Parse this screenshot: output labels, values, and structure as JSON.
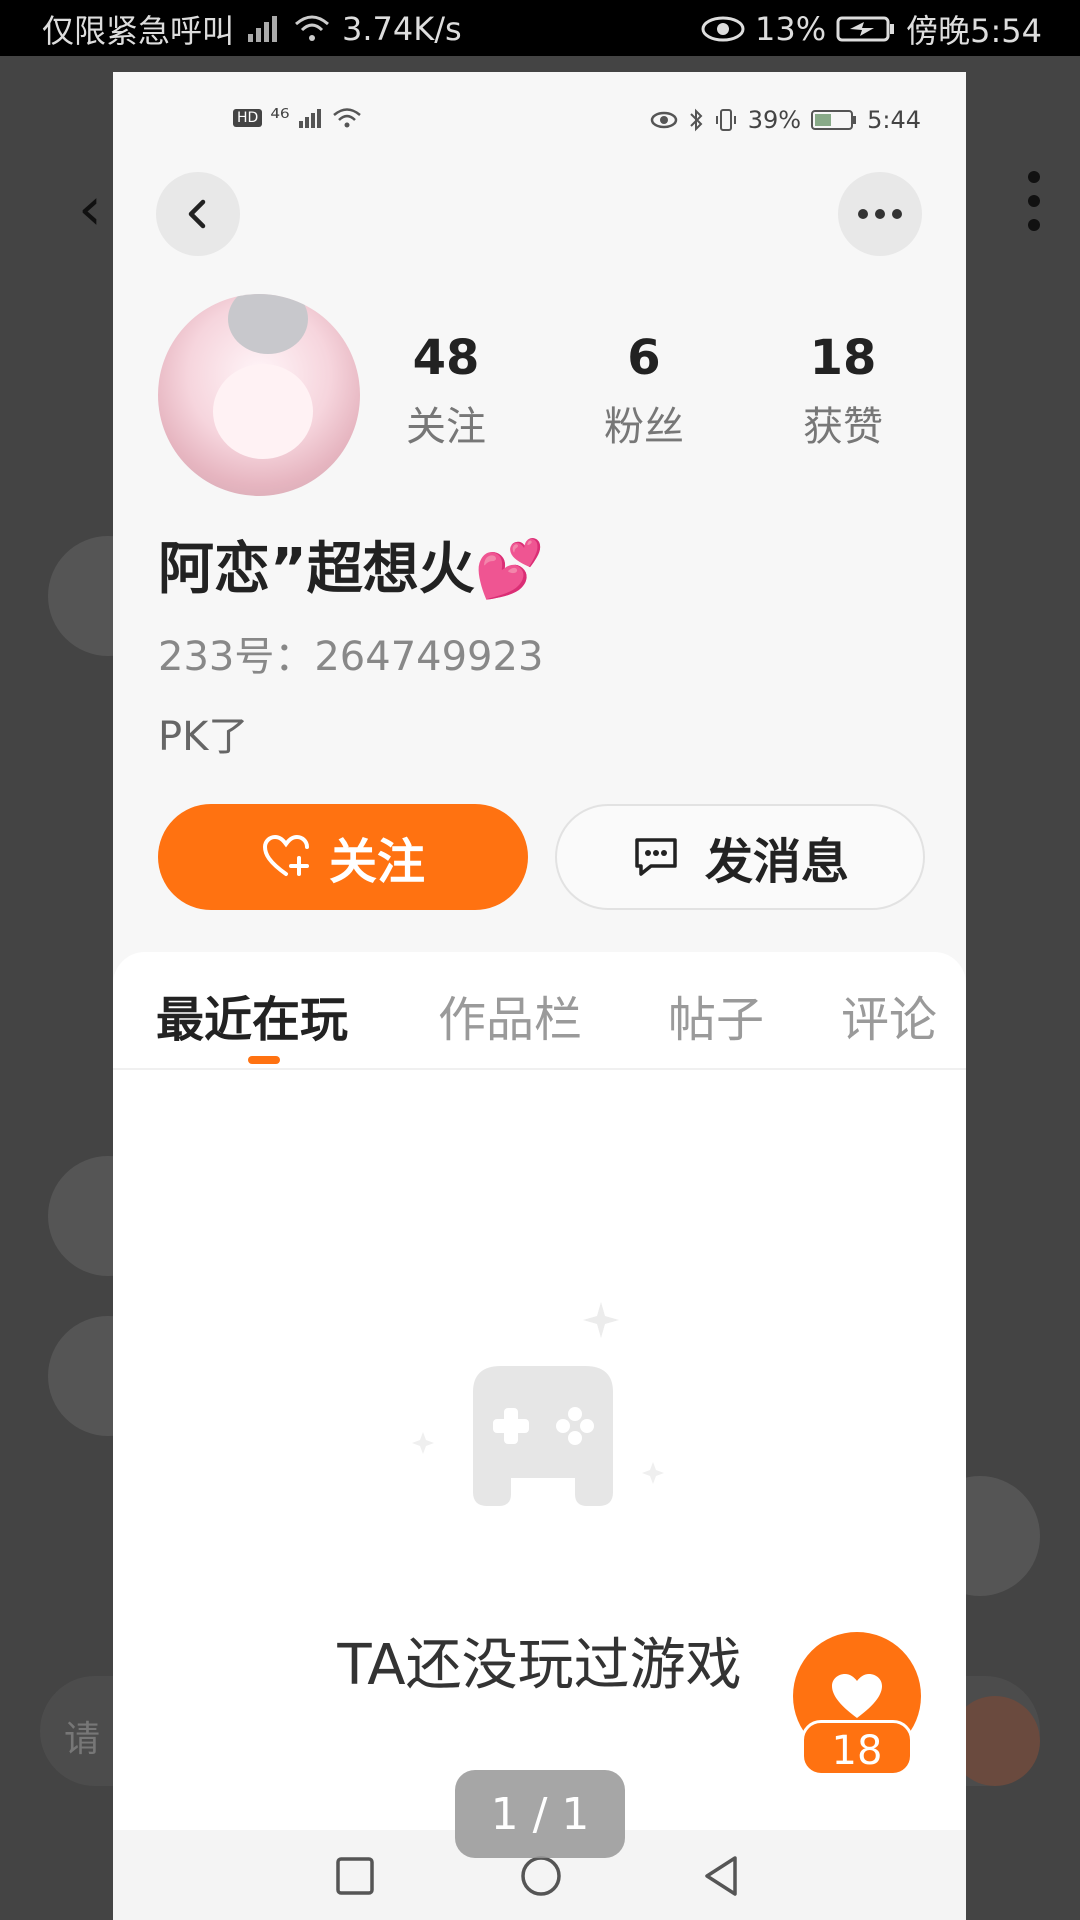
{
  "outer_status": {
    "carrier": "仅限紧急呼叫",
    "speed": "3.74K/s",
    "battery": "13%",
    "time": "傍晚5:54"
  },
  "background_app": {
    "input_placeholder": "请"
  },
  "inner_status": {
    "network": "⁴⁶",
    "battery": "39%",
    "time": "5:44"
  },
  "profile": {
    "stats": [
      {
        "num": "48",
        "label": "关注"
      },
      {
        "num": "6",
        "label": "粉丝"
      },
      {
        "num": "18",
        "label": "获赞"
      }
    ],
    "nickname": "阿恋”超想火",
    "nickname_emoji": "💕",
    "uid": "233号：264749923",
    "bio": "PK了"
  },
  "actions": {
    "follow_label": "关注",
    "message_label": "发消息"
  },
  "tabs": [
    "最近在玩",
    "作品栏",
    "帖子",
    "评论"
  ],
  "empty_state": {
    "text": "TA还没玩过游戏"
  },
  "like_fab": {
    "count": "18"
  },
  "pager": {
    "text": "1 / 1"
  },
  "colors": {
    "accent": "#ff7211"
  }
}
